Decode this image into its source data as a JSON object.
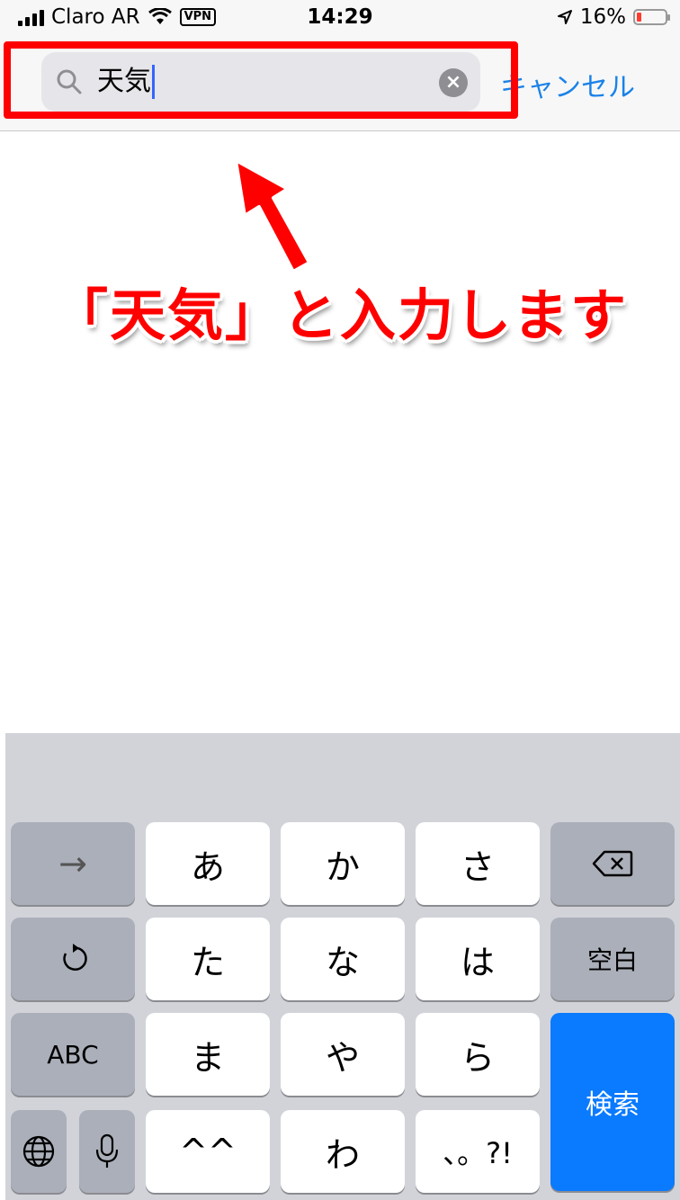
{
  "status_bar": {
    "carrier": "Claro AR",
    "vpn": "VPN",
    "time": "14:29",
    "battery": "16%",
    "battery_level": 0.16,
    "battery_color": "#ff3b30"
  },
  "search": {
    "query": "天気",
    "cancel_label": "キャンセル",
    "clear_icon": "×"
  },
  "annotation": {
    "text": "「天気」と入力します",
    "color": "#ff0000"
  },
  "keyboard": {
    "rows": [
      [
        "→",
        "あ",
        "か",
        "さ",
        "delete-icon"
      ],
      [
        "undo-icon",
        "た",
        "な",
        "は",
        "空白"
      ],
      [
        "ABC",
        "ま",
        "や",
        "ら",
        "検索"
      ],
      [
        "globe-icon",
        "mic-icon",
        "^^",
        "わ",
        "、。?!"
      ]
    ],
    "arrow_label": "→",
    "space_label": "空白",
    "abc_label": "ABC",
    "search_label": "検索",
    "accent_color": "#0a7aff",
    "keys": {
      "a": "あ",
      "ka": "か",
      "sa": "さ",
      "ta": "た",
      "na": "な",
      "ha": "は",
      "ma": "ま",
      "ya": "や",
      "ra": "ら",
      "kaomoji": "^^",
      "wa": "わ",
      "punct": "、。?!"
    }
  }
}
